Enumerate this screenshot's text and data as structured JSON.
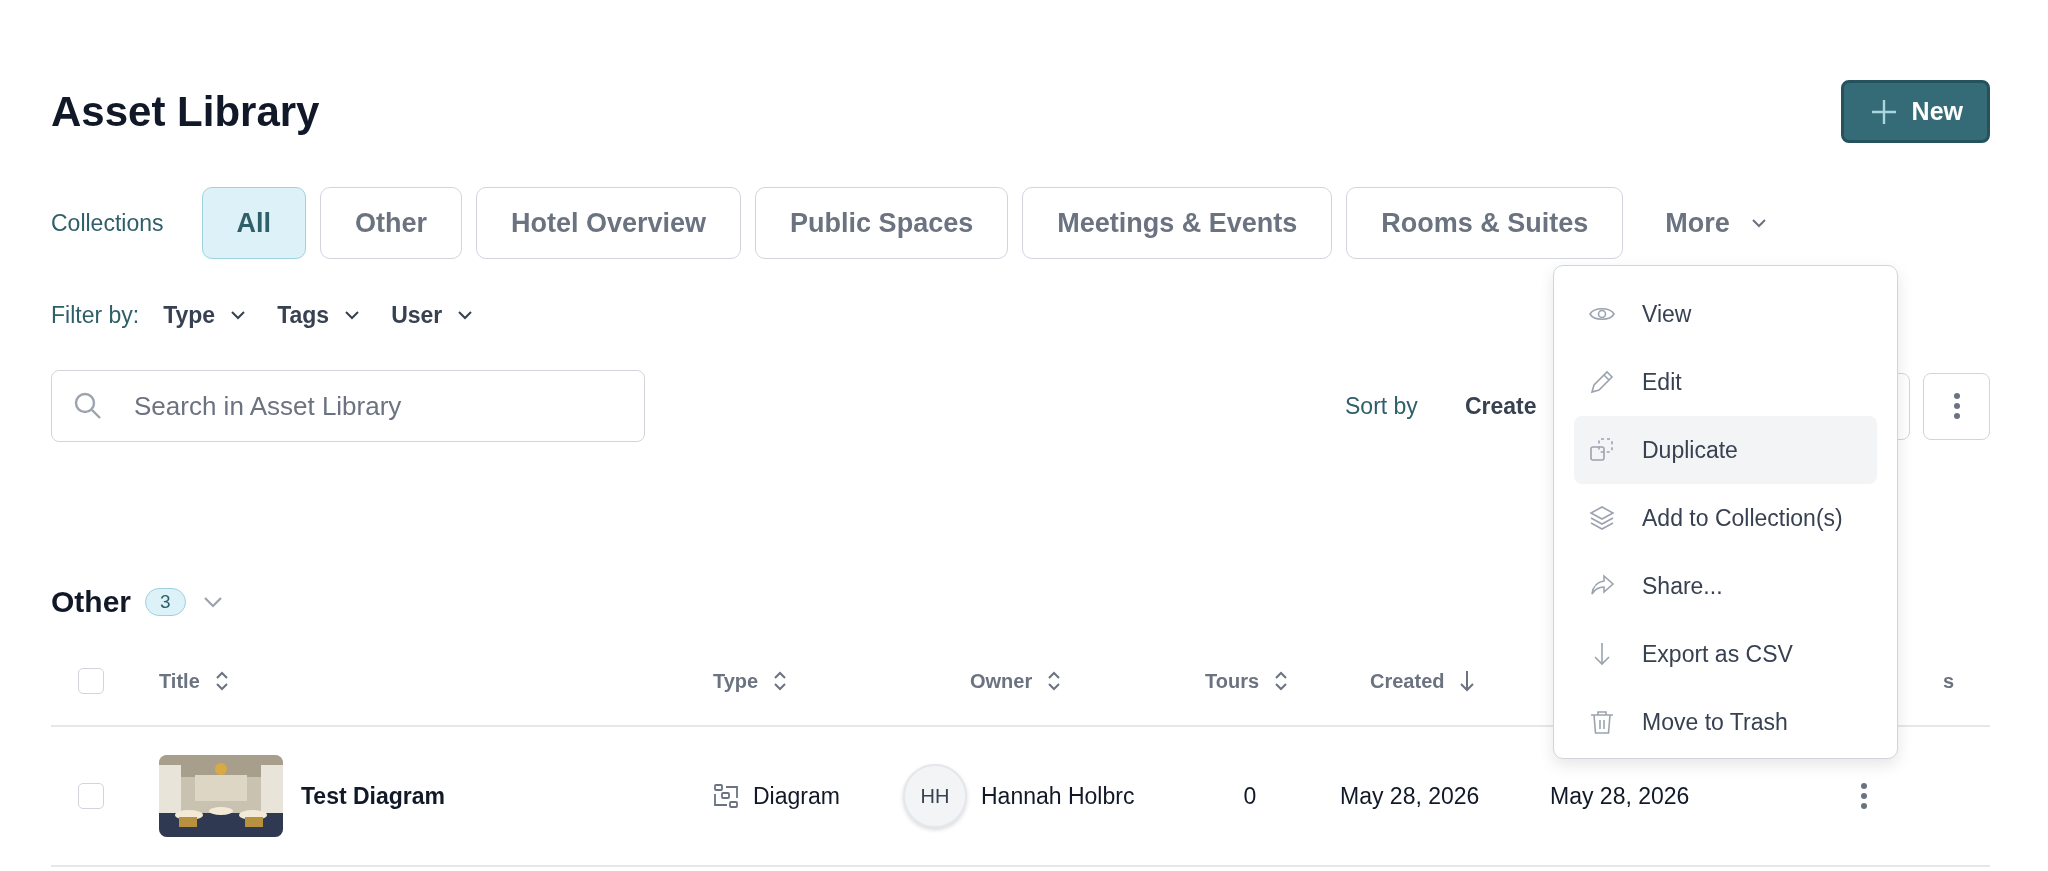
{
  "page": {
    "title": "Asset Library"
  },
  "new_button": {
    "label": "New"
  },
  "collections": {
    "label": "Collections",
    "more": "More",
    "chips": [
      {
        "label": "All",
        "selected": true
      },
      {
        "label": "Other",
        "selected": false
      },
      {
        "label": "Hotel Overview",
        "selected": false
      },
      {
        "label": "Public Spaces",
        "selected": false
      },
      {
        "label": "Meetings & Events",
        "selected": false
      },
      {
        "label": "Rooms & Suites",
        "selected": false
      }
    ]
  },
  "filters": {
    "label": "Filter by:",
    "items": [
      "Type",
      "Tags",
      "User"
    ]
  },
  "search": {
    "placeholder": "Search in Asset Library"
  },
  "sort": {
    "label": "Sort by",
    "value": "Create"
  },
  "context_menu": {
    "items": [
      {
        "label": "View",
        "selected": false
      },
      {
        "label": "Edit",
        "selected": false
      },
      {
        "label": "Duplicate",
        "selected": true
      },
      {
        "label": "Add to Collection(s)",
        "selected": false
      },
      {
        "label": "Share...",
        "selected": false
      },
      {
        "label": "Export as CSV",
        "selected": false
      },
      {
        "label": "Move to Trash",
        "selected": false
      }
    ]
  },
  "group": {
    "title": "Other",
    "count": "3",
    "expanded": true
  },
  "table": {
    "header_checked": false,
    "columns": [
      {
        "label": "Title",
        "sorted": false
      },
      {
        "label": "Type",
        "sorted": false
      },
      {
        "label": "Owner",
        "sorted": false
      },
      {
        "label": "Tours",
        "sorted": false
      },
      {
        "label": "Created",
        "sorted": true
      },
      {
        "label": "s"
      }
    ],
    "rows": [
      {
        "checked": false,
        "title": "Test Diagram",
        "type": "Diagram",
        "owner_initials": "HH",
        "owner": "Hannah Holbrc",
        "tours": "0",
        "created": "May 28, 2026",
        "column_6": "May 28, 2026"
      }
    ]
  }
}
